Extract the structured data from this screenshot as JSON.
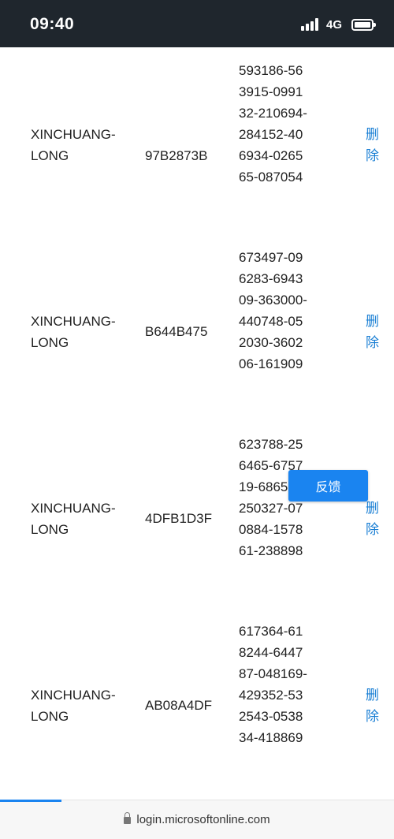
{
  "status_bar": {
    "time": "09:40",
    "network": "4G",
    "icons": [
      "signal-icon",
      "battery-icon"
    ]
  },
  "table": {
    "rows": [
      {
        "name": "XINCHUANG-LONG",
        "id": "97B2873B",
        "code": "593186-563915-099132-210694-284152-406934-026565-087054",
        "delete_label": "删除"
      },
      {
        "name": "XINCHUANG-LONG",
        "id": "B644B475",
        "code": "673497-096283-694309-363000-440748-052030-360206-161909",
        "delete_label": "删除"
      },
      {
        "name": "XINCHUANG-LONG",
        "id": "4DFB1D3F",
        "code": "623788-256465-675719-686510-250327-070884-157861-238898",
        "delete_label": "删除"
      },
      {
        "name": "XINCHUANG-LONG",
        "id": "AB08A4DF",
        "code": "617364-618244-644787-048169-429352-532543-053834-418869",
        "delete_label": "删除"
      }
    ]
  },
  "feedback_button": {
    "label": "反馈"
  },
  "browser_bar": {
    "url": "login.microsoftonline.com"
  },
  "colors": {
    "status_bar_bg": "#1f262d",
    "link": "#1a7fd4",
    "accent": "#1a84f0"
  }
}
